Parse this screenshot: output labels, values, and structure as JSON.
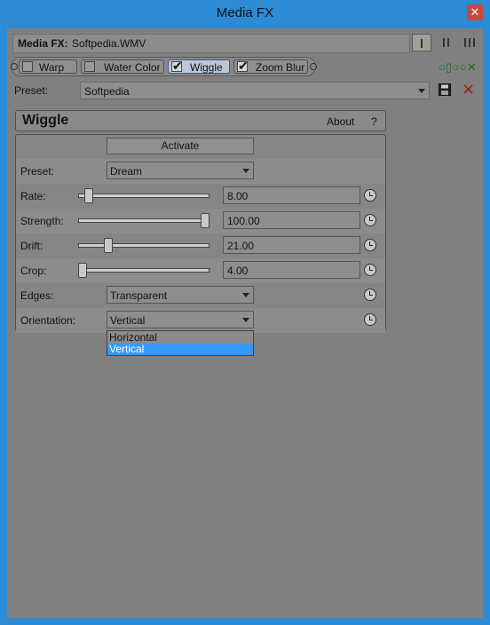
{
  "window": {
    "title": "Media FX",
    "close_glyph": "✕"
  },
  "media_fx": {
    "label": "Media FX:",
    "file": "Softpedia.WMV"
  },
  "chain": [
    {
      "label": "Warp",
      "checked": false
    },
    {
      "label": "Water Color",
      "checked": false
    },
    {
      "label": "Wiggle",
      "checked": true,
      "active": true
    },
    {
      "label": "Zoom Blur",
      "checked": true
    }
  ],
  "preset_row": {
    "label": "Preset:",
    "value": "Softpedia"
  },
  "plugin": {
    "name": "Wiggle",
    "about": "About",
    "help": "?"
  },
  "panel": {
    "activate": "Activate",
    "preset": {
      "label": "Preset:",
      "value": "Dream"
    },
    "rate": {
      "label": "Rate:",
      "value": "8.00",
      "level": 0.05
    },
    "strength": {
      "label": "Strength:",
      "value": "100.00",
      "level": 1.0
    },
    "drift": {
      "label": "Drift:",
      "value": "21.00",
      "level": 0.21
    },
    "crop": {
      "label": "Crop:",
      "value": "4.00",
      "level": 0.0
    },
    "edges": {
      "label": "Edges:",
      "value": "Transparent"
    },
    "orientation": {
      "label": "Orientation:",
      "value": "Vertical"
    }
  },
  "orientation_options": [
    "Horizontal",
    "Vertical"
  ],
  "colors": {
    "titlebar": "#2b8bd6",
    "background": "#808080",
    "selection": "#3399ff"
  }
}
